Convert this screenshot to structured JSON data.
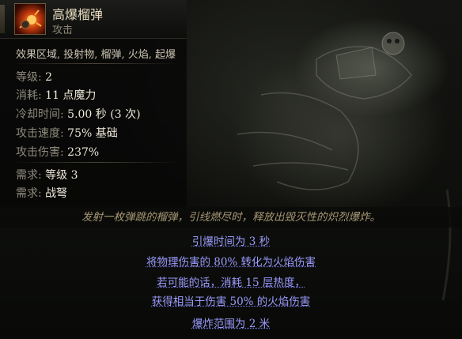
{
  "skill": {
    "name": "高爆榴弹",
    "type": "攻击",
    "tags": "效果区域, 投射物, 榴弹, 火焰, 起爆"
  },
  "stats": [
    {
      "label": "等级:",
      "value": "2"
    },
    {
      "label": "消耗:",
      "value": "11 点魔力"
    },
    {
      "label": "冷却时间:",
      "value": "5.00 秒 (3 次)"
    },
    {
      "label": "攻击速度:",
      "value": "75% 基础"
    },
    {
      "label": "攻击伤害:",
      "value": "237%"
    }
  ],
  "requirements": [
    {
      "label": "需求:",
      "value": "等级 3"
    },
    {
      "label": "需求:",
      "value": "战弩"
    }
  ],
  "description": "发射一枚弹跳的榴弹，引线燃尽时，释放出毁灭性的炽烈爆炸。",
  "modifiers": [
    "引爆时间为 3 秒",
    "将物理伤害的 80% 转化为火焰伤害",
    "若可能的话，消耗 15 层热度，",
    "获得相当于伤害 50% 的火焰伤害",
    "爆炸范围为 2 米"
  ],
  "colors": {
    "name": "#e8dcc0",
    "label": "#8f8a7c",
    "value": "#ece6d6",
    "description": "#a69673",
    "modifier": "#9c9cff"
  },
  "icons": {
    "skill_icon": "grenade-explosion-icon"
  }
}
